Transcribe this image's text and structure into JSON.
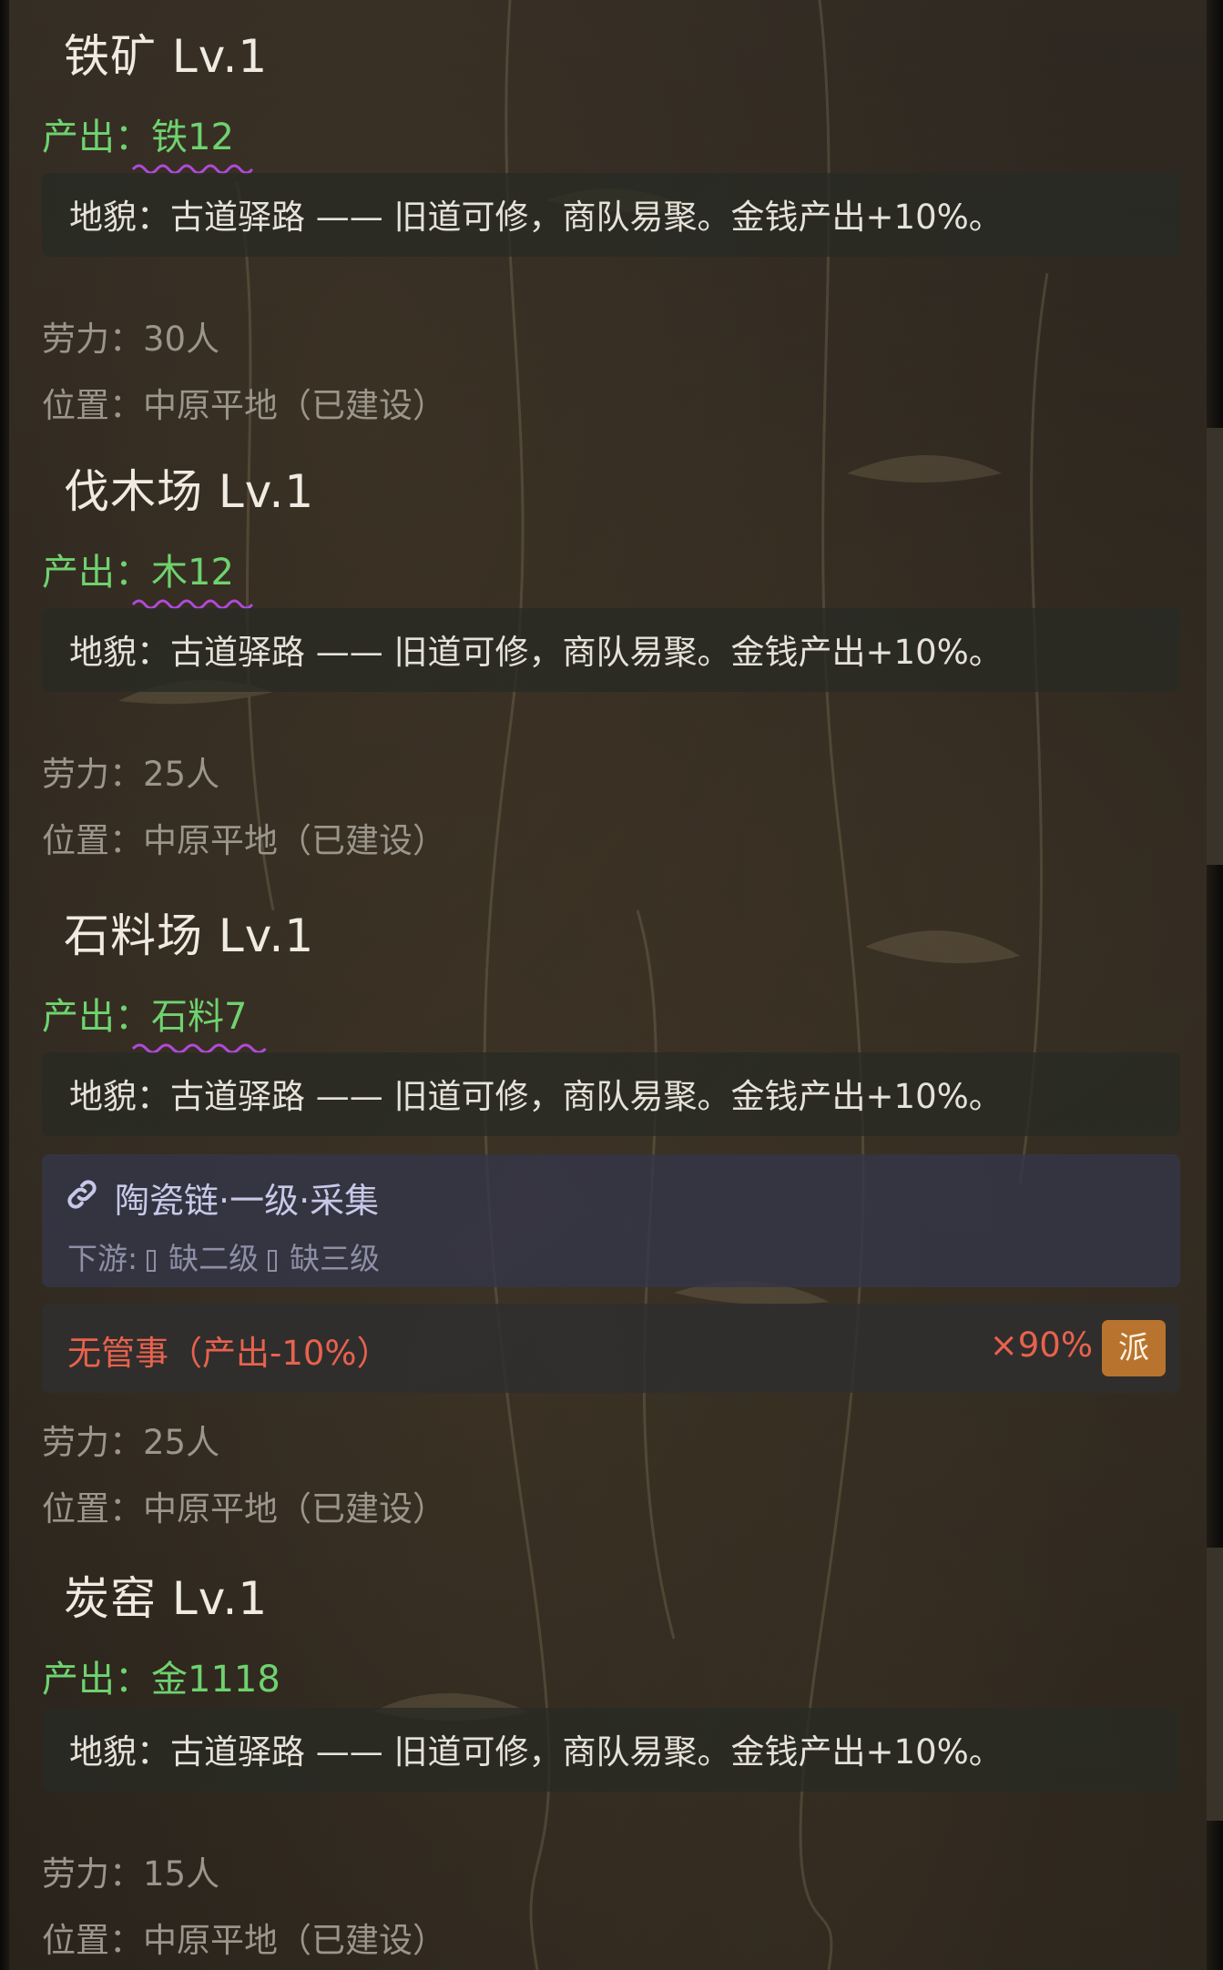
{
  "buildings": [
    {
      "title": "铁矿 Lv.1",
      "output_label": "产出：",
      "output_value": "铁12",
      "terrain": "地貌：古道驿路 —— 旧道可修，商队易聚。金钱产出+10%。",
      "labor": "劳力：30人",
      "location": "位置：中原平地（已建设）"
    },
    {
      "title": "伐木场 Lv.1",
      "output_label": "产出：",
      "output_value": "木12",
      "terrain": "地貌：古道驿路 —— 旧道可修，商队易聚。金钱产出+10%。",
      "labor": "劳力：25人",
      "location": "位置：中原平地（已建设）"
    },
    {
      "title": "石料场 Lv.1",
      "output_label": "产出：",
      "output_value": "石料7",
      "terrain": "地貌：古道驿路 —— 旧道可修，商队易聚。金钱产出+10%。",
      "chain": {
        "icon": "link-icon",
        "title": "陶瓷链·一级·采集",
        "downstream_label": "下游:",
        "missing_level_2": "缺二级",
        "missing_level_3": "缺三级"
      },
      "warning": {
        "text": "无管事（产出-10%）",
        "rate": "×90%",
        "button": "派"
      },
      "labor": "劳力：25人",
      "location": "位置：中原平地（已建设）"
    },
    {
      "title": "炭窑 Lv.1",
      "output_label": "产出：",
      "output_value": "金1118",
      "terrain": "地貌：古道驿路 —— 旧道可修，商队易聚。金钱产出+10%。",
      "labor": "劳力：15人",
      "location": "位置：中原平地（已建设）"
    }
  ],
  "colors": {
    "output_green": "#6fd26f",
    "warning_red": "#e8624e",
    "dispatch_button": "#b8742e",
    "spellcheck_squiggle": "#b04ad8"
  }
}
